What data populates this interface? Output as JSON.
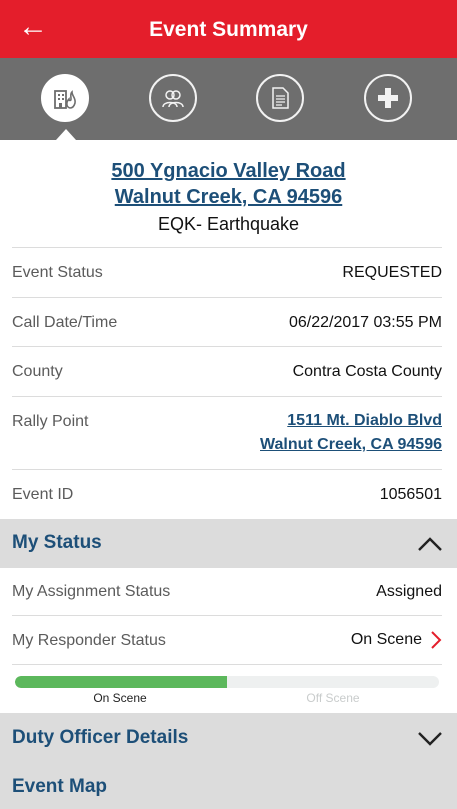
{
  "header": {
    "back_icon": "arrow-left-icon",
    "title": "Event Summary"
  },
  "tabs": [
    {
      "icon": "building-fire-icon",
      "active": true
    },
    {
      "icon": "people-icon",
      "active": false
    },
    {
      "icon": "document-icon",
      "active": false
    },
    {
      "icon": "medical-cross-icon",
      "active": false
    }
  ],
  "event": {
    "address_line1": "500 Ygnacio Valley Road",
    "address_line2": "Walnut Creek, CA 94596",
    "type": "EQK- Earthquake"
  },
  "details": {
    "status_label": "Event Status",
    "status_value": "REQUESTED",
    "call_label": "Call Date/Time",
    "call_value": "06/22/2017 03:55 PM",
    "county_label": "County",
    "county_value": "Contra Costa County",
    "rally_label": "Rally Point",
    "rally_line1": "1511 Mt. Diablo Blvd",
    "rally_line2": "Walnut Creek, CA 94596",
    "id_label": "Event ID",
    "id_value": "1056501"
  },
  "my_status": {
    "title": "My Status",
    "assignment_label": "My Assignment Status",
    "assignment_value": "Assigned",
    "responder_label": "My Responder Status",
    "responder_value": "On Scene",
    "progress": {
      "fraction": 0.5,
      "left_label": "On Scene",
      "right_label": "Off Scene"
    }
  },
  "duty_officer": {
    "title": "Duty Officer Details"
  },
  "event_map": {
    "title": "Event Map"
  },
  "colors": {
    "header": "#e41e2b",
    "link": "#1d4f78",
    "progress": "#5cb85c",
    "chevron_right": "#e41e2b"
  }
}
